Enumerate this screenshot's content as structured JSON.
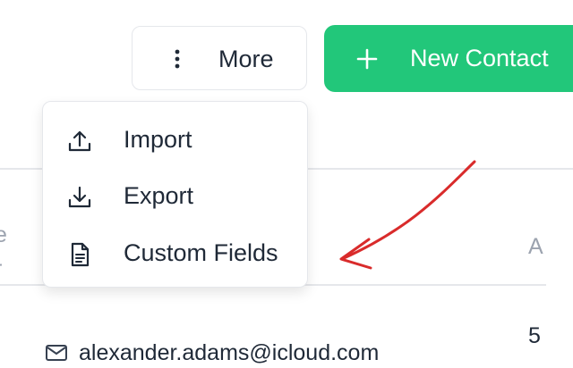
{
  "toolbar": {
    "more_label": "More",
    "more_icon": "vertical-dots-icon",
    "new_contact_label": "New Contact",
    "new_contact_icon": "plus-icon",
    "accent_color": "#22c77a"
  },
  "dropdown": {
    "items": [
      {
        "label": "Import",
        "icon": "upload-icon"
      },
      {
        "label": "Export",
        "icon": "download-icon"
      },
      {
        "label": "Custom Fields",
        "icon": "document-icon"
      }
    ]
  },
  "table": {
    "header_left_partial": "e\nr",
    "header_right_partial": "A",
    "row_email": "alexander.adams@icloud.com",
    "row_right_partial": "5"
  },
  "annotation": {
    "color": "#d92b2b",
    "icon": "curved-arrow-icon"
  }
}
